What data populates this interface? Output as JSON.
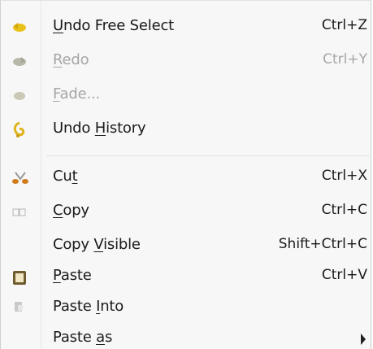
{
  "menu": {
    "items": [
      {
        "id": "undo",
        "label_pre": "",
        "label_ul": "U",
        "label_post": "ndo Free Select",
        "shortcut": "Ctrl+Z",
        "icon": "undo-icon",
        "enabled": true
      },
      {
        "id": "redo",
        "label_pre": "",
        "label_ul": "R",
        "label_post": "edo",
        "shortcut": "Ctrl+Y",
        "icon": "redo-icon",
        "enabled": false
      },
      {
        "id": "fade",
        "label_pre": "",
        "label_ul": "F",
        "label_post": "ade...",
        "shortcut": "",
        "icon": "fade-icon",
        "enabled": false
      },
      {
        "id": "undo-history",
        "label_pre": "Undo ",
        "label_ul": "H",
        "label_post": "istory",
        "shortcut": "",
        "icon": "undo-history-icon",
        "enabled": true
      },
      {
        "id": "cut",
        "label_pre": "Cu",
        "label_ul": "t",
        "label_post": "",
        "shortcut": "Ctrl+X",
        "icon": "scissors-icon",
        "enabled": true
      },
      {
        "id": "copy",
        "label_pre": "",
        "label_ul": "C",
        "label_post": "opy",
        "shortcut": "Ctrl+C",
        "icon": "copy-icon",
        "enabled": true
      },
      {
        "id": "copy-visible",
        "label_pre": "Copy ",
        "label_ul": "V",
        "label_post": "isible",
        "shortcut": "Shift+Ctrl+C",
        "icon": "",
        "enabled": true
      },
      {
        "id": "paste",
        "label_pre": "",
        "label_ul": "P",
        "label_post": "aste",
        "shortcut": "Ctrl+V",
        "icon": "paste-icon",
        "enabled": true
      },
      {
        "id": "paste-into",
        "label_pre": "Paste ",
        "label_ul": "I",
        "label_post": "nto",
        "shortcut": "",
        "icon": "paste-into-icon",
        "enabled": true
      },
      {
        "id": "paste-as",
        "label_pre": "Paste ",
        "label_ul": "a",
        "label_post": "s",
        "shortcut": "",
        "icon": "",
        "enabled": true,
        "submenu": true
      }
    ]
  }
}
